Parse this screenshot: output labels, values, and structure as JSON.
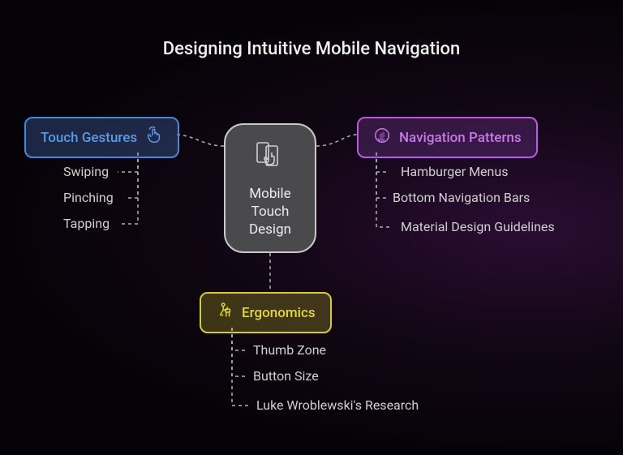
{
  "title": "Designing Intuitive Mobile Navigation",
  "central": {
    "label": "Mobile\nTouch\nDesign"
  },
  "branches": {
    "touch": {
      "label": "Touch Gestures",
      "items": [
        "Swiping",
        "Pinching",
        "Tapping"
      ]
    },
    "nav": {
      "label": "Navigation Patterns",
      "items": [
        "Hamburger Menus",
        "Bottom Navigation Bars",
        "Material Design Guidelines"
      ]
    },
    "ergo": {
      "label": "Ergonomics",
      "items": [
        "Thumb Zone",
        "Button Size",
        "Luke Wroblewski's Research"
      ]
    }
  }
}
